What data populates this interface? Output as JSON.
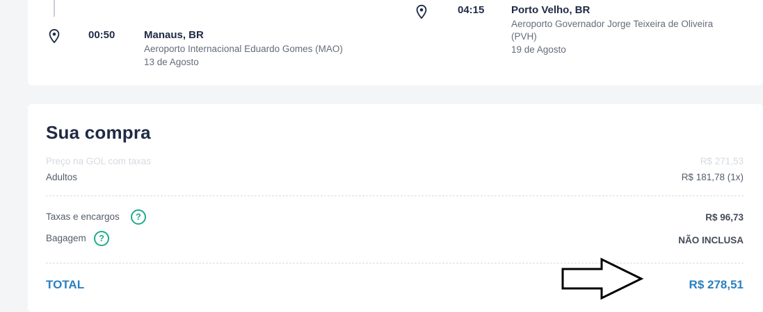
{
  "flight": {
    "departure": {
      "time": "00:50",
      "city": "Manaus, BR",
      "airport": "Aeroporto Internacional Eduardo Gomes (MAO)",
      "date": "13 de Agosto"
    },
    "arrival": {
      "time": "04:15",
      "city": "Porto Velho, BR",
      "airport_line1": "Aeroporto Governador Jorge Teixeira de Oliveira",
      "airport_line2": "(PVH)",
      "date": "19 de Agosto"
    }
  },
  "purchase": {
    "title": "Sua compra",
    "price_gol_label": "Preço na GOL com taxas",
    "price_gol_value": "R$ 271,53",
    "adults_label": "Adultos",
    "adults_value": "R$ 181,78 (1x)",
    "taxes_label": "Taxas e encargos",
    "taxes_value": "R$ 96,73",
    "baggage_label": "Bagagem",
    "baggage_value": "NÃO INCLUSA",
    "help_glyph": "?",
    "total_label": "TOTAL",
    "total_value": "R$ 278,51"
  },
  "icons": {
    "pin": "map-pin-icon",
    "help": "help-circle-icon",
    "arrow": "arrow-right-icon"
  },
  "colors": {
    "accent_blue": "#2b7fc0",
    "help_green": "#1eaa8c",
    "title_dark": "#1f2a44"
  }
}
